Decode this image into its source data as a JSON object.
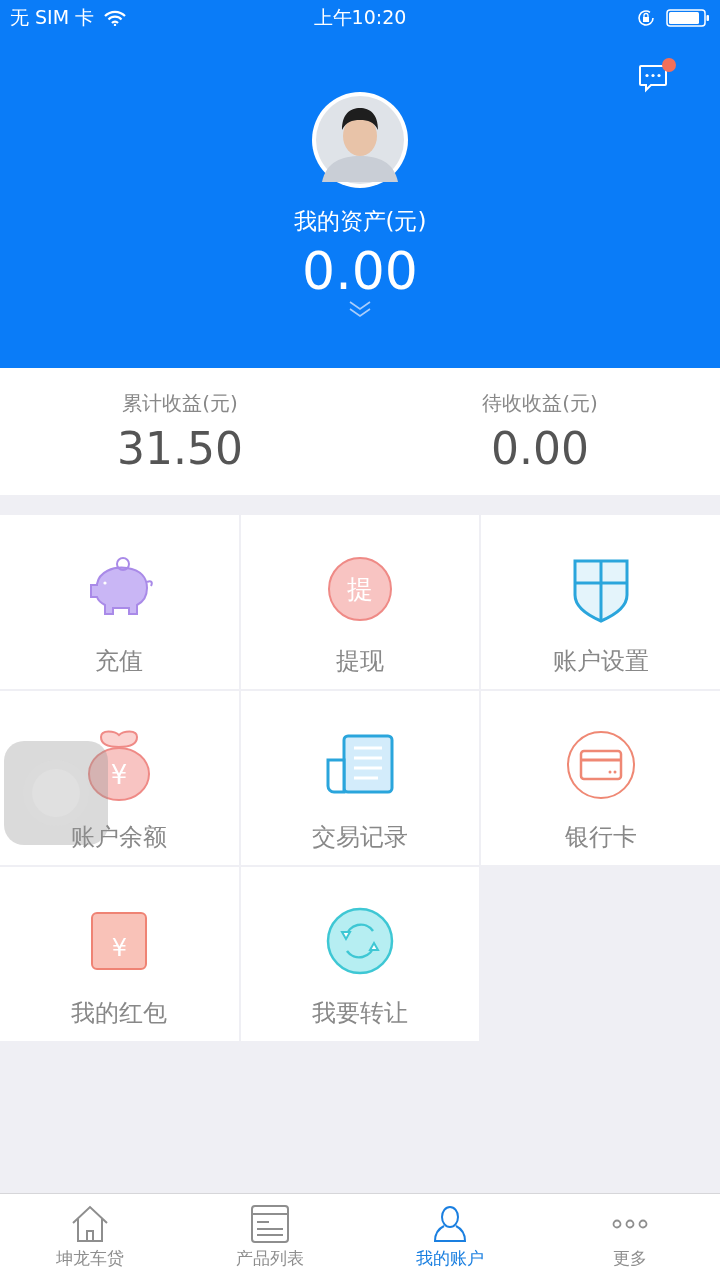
{
  "status_bar": {
    "carrier": "无 SIM 卡",
    "time": "上午10:20"
  },
  "header": {
    "messages_unread": true,
    "title": "我的资产(元)",
    "amount": "0.00"
  },
  "stats": [
    {
      "label": "累计收益(元)",
      "value": "31.50"
    },
    {
      "label": "待收收益(元)",
      "value": "0.00"
    }
  ],
  "menu": [
    {
      "kind": "piggy",
      "label": "充值"
    },
    {
      "kind": "withdraw",
      "label": "提现",
      "icon_text": "提"
    },
    {
      "kind": "shield",
      "label": "账户设置"
    },
    {
      "kind": "moneybag",
      "label": "账户余额",
      "icon_text": "¥"
    },
    {
      "kind": "receipt",
      "label": "交易记录"
    },
    {
      "kind": "card",
      "label": "银行卡"
    },
    {
      "kind": "envelope",
      "label": "我的红包",
      "icon_text": "¥"
    },
    {
      "kind": "transfer",
      "label": "我要转让"
    }
  ],
  "tab_bar": [
    {
      "kind": "home",
      "label": "坤龙车贷",
      "selected": false
    },
    {
      "kind": "list",
      "label": "产品列表",
      "selected": false
    },
    {
      "kind": "person",
      "label": "我的账户",
      "selected": true
    },
    {
      "kind": "more",
      "label": "更多",
      "selected": false
    }
  ]
}
